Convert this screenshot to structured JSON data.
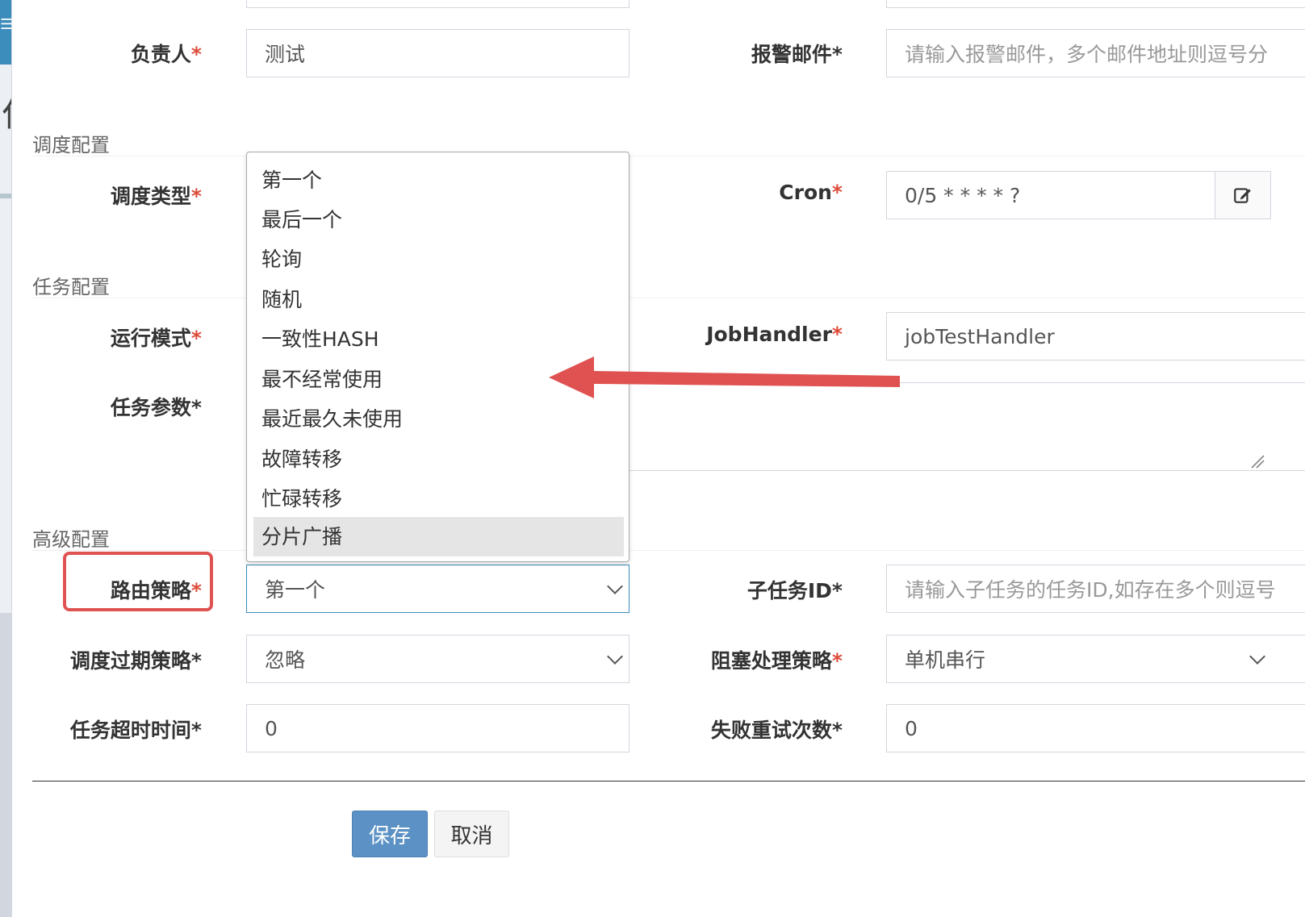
{
  "header": {
    "left_glyph": "仁"
  },
  "fields": {
    "owner": {
      "label": "负责人",
      "star": "*",
      "value": "测试"
    },
    "alarm_email": {
      "label": "报警邮件",
      "star": "*",
      "placeholder": "请输入报警邮件，多个邮件地址则逗号分"
    },
    "schedule_type": {
      "label": "调度类型",
      "star": "*"
    },
    "cron": {
      "label": "Cron",
      "star": "*",
      "value": "0/5 * * * * ?"
    },
    "run_mode": {
      "label": "运行模式",
      "star": "*"
    },
    "job_handler": {
      "label": "JobHandler",
      "star": "*",
      "value": "jobTestHandler"
    },
    "job_param": {
      "label": "任务参数*"
    },
    "route_strategy": {
      "label": "路由策略",
      "star": "*",
      "value": "第一个"
    },
    "child_job": {
      "label": "子任务ID*",
      "placeholder": "请输入子任务的任务ID,如存在多个则逗号"
    },
    "misfire": {
      "label": "调度过期策略*",
      "value": "忽略"
    },
    "block": {
      "label": "阻塞处理策略",
      "star": "*",
      "value": "单机串行"
    },
    "timeout": {
      "label": "任务超时时间*",
      "value": "0"
    },
    "retry": {
      "label": "失败重试次数*",
      "value": "0"
    }
  },
  "sections": {
    "schedule": "调度配置",
    "task": "任务配置",
    "advanced": "高级配置"
  },
  "dropdown": {
    "options": [
      "第一个",
      "最后一个",
      "轮询",
      "随机",
      "一致性HASH",
      "最不经常使用",
      "最近最久未使用",
      "故障转移",
      "忙碌转移",
      "分片广播"
    ],
    "highlighted_index": 9
  },
  "buttons": {
    "save": "保存",
    "cancel": "取消"
  },
  "colors": {
    "accent": "#3c8dbc",
    "annotation_red": "#e05252"
  },
  "icons": {
    "cron_edit": "edit-icon",
    "menu": "hamburger-icon"
  }
}
